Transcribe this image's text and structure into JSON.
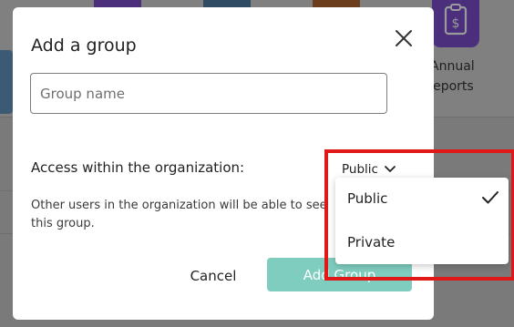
{
  "background": {
    "tile_label_line1": "Annual",
    "tile_label_line2": "Reports",
    "tile_colors": [
      "#4b2f7d",
      "#2f4a63",
      "#6b3d1c",
      "#4b2f7d"
    ]
  },
  "dialog": {
    "title": "Add a group",
    "close_icon": "close-icon",
    "group_name": {
      "value": "",
      "placeholder": "Group name"
    },
    "access": {
      "label": "Access within the organization:",
      "selected": "Public",
      "chevron_icon": "chevron-down-icon",
      "options": [
        {
          "label": "Public",
          "selected": true
        },
        {
          "label": "Private",
          "selected": false
        }
      ]
    },
    "description": "Other users in the organization will be able to see this group.",
    "cancel_label": "Cancel",
    "add_label": "Add Group",
    "accent_color": "#7fcdbf"
  },
  "annotation": {
    "highlight_color": "#e01818"
  }
}
